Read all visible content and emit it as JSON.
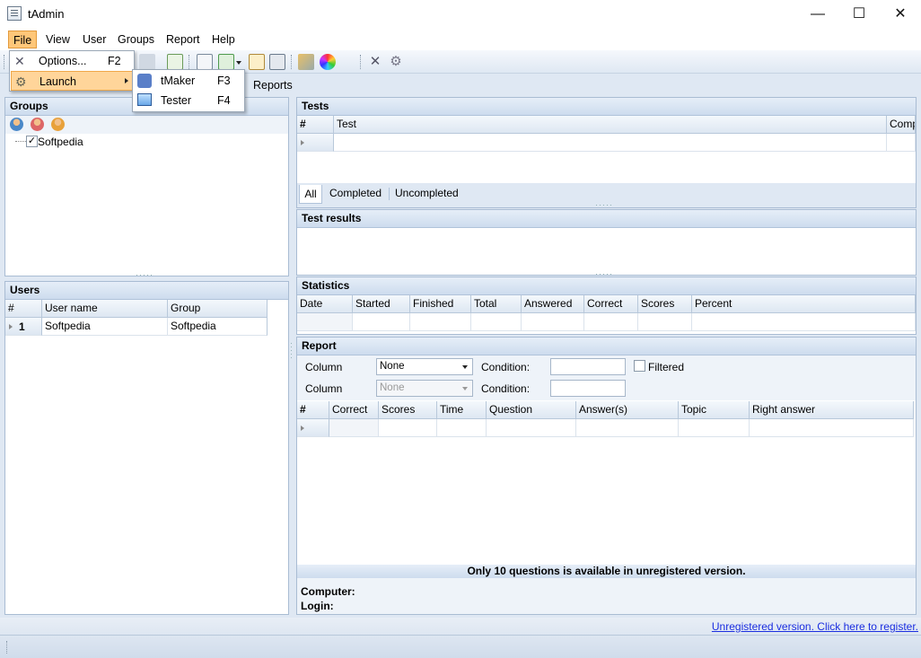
{
  "window": {
    "title": "tAdmin",
    "min_glyph": "—",
    "max_glyph": "☐",
    "close_glyph": "✕"
  },
  "menubar": {
    "items": [
      "File",
      "View",
      "User",
      "Groups",
      "Report",
      "Help"
    ]
  },
  "file_menu": {
    "items": [
      {
        "label": "Options...",
        "shortcut": "F2",
        "icon": "options-icon"
      },
      {
        "label": "Launch",
        "shortcut": "",
        "icon": "launch-icon",
        "has_submenu": true
      }
    ]
  },
  "launch_submenu": {
    "items": [
      {
        "label": "tMaker",
        "shortcut": "F3",
        "icon": "tmaker-icon"
      },
      {
        "label": "Tester",
        "shortcut": "F4",
        "icon": "tester-icon"
      }
    ]
  },
  "tabs": {
    "reports": "Reports"
  },
  "groups": {
    "header": "Groups",
    "tree": [
      {
        "label": "Softpedia",
        "checked": true
      }
    ]
  },
  "users": {
    "header": "Users",
    "columns": [
      "#",
      "User name",
      "Group"
    ],
    "rows": [
      {
        "num": "1",
        "name": "Softpedia",
        "group": "Softpedia"
      }
    ]
  },
  "tests": {
    "header": "Tests",
    "columns": [
      "#",
      "Test",
      "Comp"
    ],
    "filter_tabs": [
      "All",
      "Completed",
      "Uncompleted"
    ],
    "active_tab": "All"
  },
  "test_results": {
    "header": "Test results"
  },
  "statistics": {
    "header": "Statistics",
    "columns": [
      "Date",
      "Started",
      "Finished",
      "Total",
      "Answered",
      "Correct",
      "Scores",
      "Percent"
    ]
  },
  "report": {
    "header": "Report",
    "filters": [
      {
        "label": "Column",
        "value": "None",
        "enabled": true,
        "condition_label": "Condition:"
      },
      {
        "label": "Column",
        "value": "None",
        "enabled": false,
        "condition_label": "Condition:"
      }
    ],
    "filtered_label": "Filtered",
    "columns": [
      "#",
      "Correct",
      "Scores",
      "Time",
      "Question",
      "Answer(s)",
      "Topic",
      "Right answer"
    ],
    "notice": "Only 10 questions is available in unregistered version.",
    "computer_label": "Computer:",
    "login_label": "Login:"
  },
  "status": {
    "register_link": "Unregistered version. Click here to register."
  },
  "colors": {
    "accent": "#ffc779",
    "panel_header": "#cddcee",
    "link": "#1b2ee0"
  }
}
